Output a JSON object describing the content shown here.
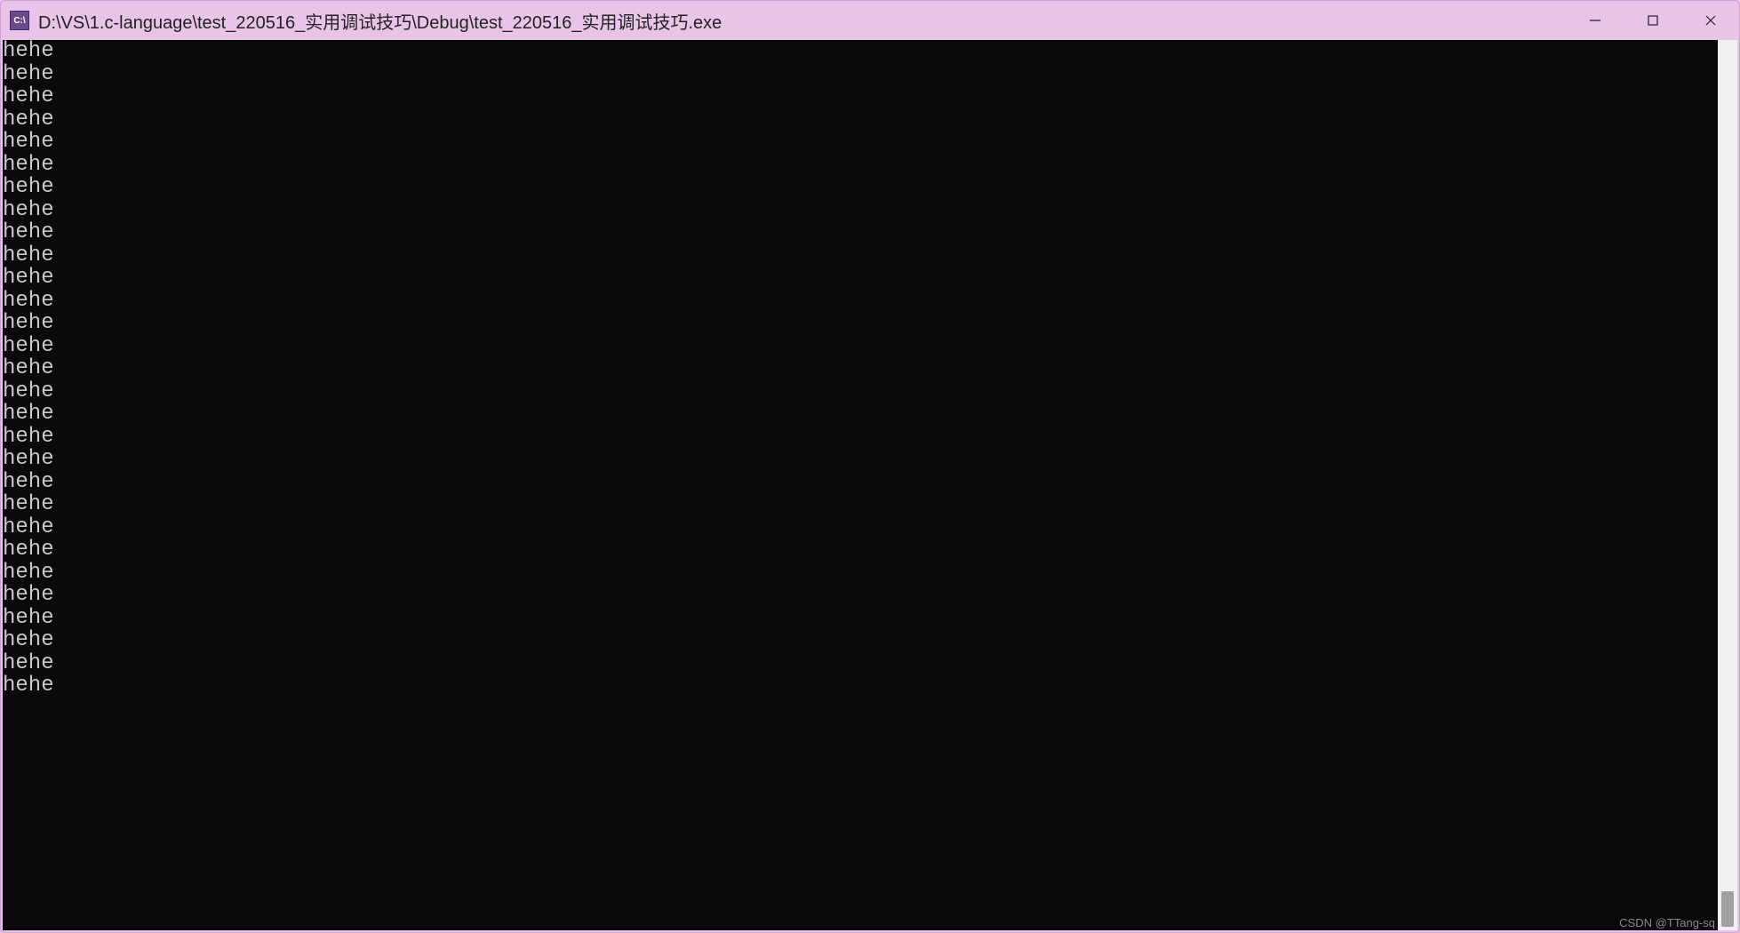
{
  "window": {
    "title": "D:\\VS\\1.c-language\\test_220516_实用调试技巧\\Debug\\test_220516_实用调试技巧.exe",
    "app_icon_text": "C:\\"
  },
  "console": {
    "lines": [
      "hehe",
      "hehe",
      "hehe",
      "hehe",
      "hehe",
      "hehe",
      "hehe",
      "hehe",
      "hehe",
      "hehe",
      "hehe",
      "hehe",
      "hehe",
      "hehe",
      "hehe",
      "hehe",
      "hehe",
      "hehe",
      "hehe",
      "hehe",
      "hehe",
      "hehe",
      "hehe",
      "hehe",
      "hehe",
      "hehe",
      "hehe",
      "hehe",
      "hehe"
    ]
  },
  "watermark": "CSDN @TTang-sq"
}
